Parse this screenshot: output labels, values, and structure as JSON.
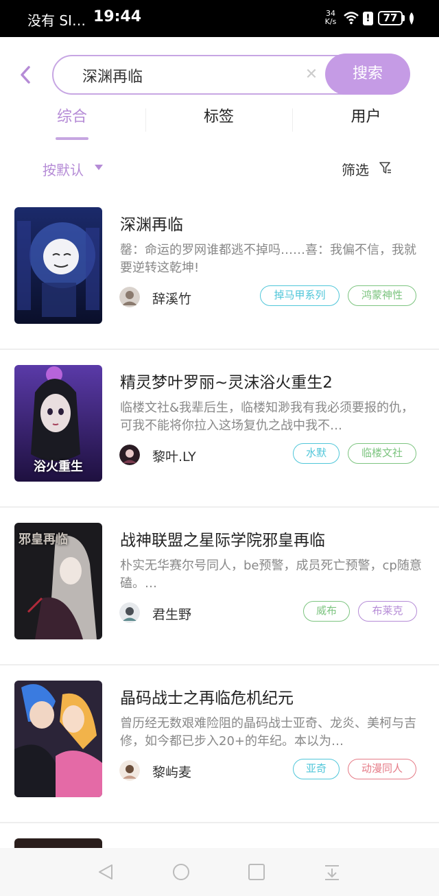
{
  "status_bar": {
    "carrier": "没有 SI…",
    "time": "19:44",
    "speed_value": "34",
    "speed_unit": "K/s",
    "battery": "77"
  },
  "search": {
    "value": "深渊再临",
    "button_label": "搜索"
  },
  "tabs": [
    {
      "label": "综合",
      "active": true
    },
    {
      "label": "标签",
      "active": false
    },
    {
      "label": "用户",
      "active": false
    }
  ],
  "sort": {
    "label": "按默认",
    "filter_label": "筛选"
  },
  "colors": {
    "accent": "#c59be5",
    "accent_text": "#b58bd6"
  },
  "books": [
    {
      "title": "深渊再临",
      "desc": "罄：命运的罗网谁都逃不掉吗……喜：我偏不信，我就要逆转这乾坤!",
      "author": "辞溪竹",
      "tags": [
        {
          "label": "掉马甲系列",
          "color": "#4fc6d9"
        },
        {
          "label": "鸿蒙神性",
          "color": "#7cc47f"
        }
      ]
    },
    {
      "title": "精灵梦叶罗丽~灵沫浴火重生2",
      "desc": "临楼文社&我辈后生，临楼知渺我有我必须要报的仇，可我不能将你拉入这场复仇之战中我不…",
      "author": "黎叶.LY",
      "cover_text": "浴火重生",
      "tags": [
        {
          "label": "水默",
          "color": "#4fc6d9"
        },
        {
          "label": "临楼文社",
          "color": "#7cc47f"
        }
      ]
    },
    {
      "title": "战神联盟之星际学院邪皇再临",
      "desc": "朴实无华赛尔号同人，be预警，成员死亡预警，cp随意磕。…",
      "author": "君生野",
      "cover_text": "邪皇再临",
      "tags": [
        {
          "label": "威布",
          "color": "#7cc47f"
        },
        {
          "label": "布莱克",
          "color": "#b58bd6"
        }
      ]
    },
    {
      "title": "晶码战士之再临危机纪元",
      "desc": "曾历经无数艰难险阻的晶码战士亚奇、龙炎、美柯与吉修，如今都已步入20+的年纪。本以为…",
      "author": "黎屿麦",
      "tags": [
        {
          "label": "亚奇",
          "color": "#4fc6d9"
        },
        {
          "label": "动漫同人",
          "color": "#e57a86"
        }
      ]
    }
  ]
}
